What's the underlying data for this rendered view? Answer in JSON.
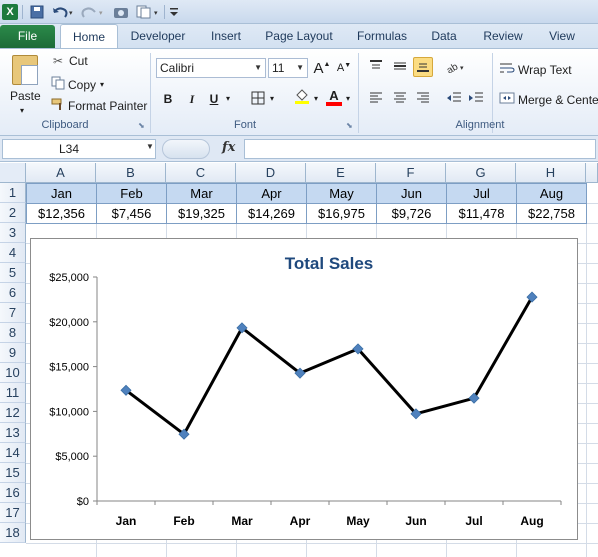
{
  "titlebar": {
    "logo": "X",
    "qa_icons": [
      "save-icon",
      "undo-icon",
      "redo-icon",
      "camera-icon",
      "copy-format-icon",
      "customize-icon"
    ]
  },
  "tabs": [
    "File",
    "Home",
    "Developer",
    "Insert",
    "Page Layout",
    "Formulas",
    "Data",
    "Review",
    "View"
  ],
  "ribbon": {
    "clipboard": {
      "paste": "Paste",
      "cut": "Cut",
      "copy": "Copy",
      "format_painter": "Format Painter",
      "label": "Clipboard"
    },
    "font": {
      "name": "Calibri",
      "size": "11",
      "grow": "A",
      "shrink": "A",
      "bold": "B",
      "italic": "I",
      "underline": "U",
      "fill_letter": "A",
      "label": "Font",
      "fill_color": "#ffff00",
      "font_color": "#ff0000"
    },
    "alignment": {
      "wrap_text": "Wrap Text",
      "merge_center": "Merge & Center",
      "label": "Alignment"
    }
  },
  "formula_bar": {
    "name_box": "L34",
    "fx": "fx",
    "formula": ""
  },
  "columns": [
    "A",
    "B",
    "C",
    "D",
    "E",
    "F",
    "G",
    "H"
  ],
  "rows": [
    "1",
    "2",
    "3",
    "4",
    "5",
    "6",
    "7",
    "8",
    "9",
    "10",
    "11",
    "12",
    "13",
    "14",
    "15",
    "16",
    "17",
    "18"
  ],
  "months": [
    "Jan",
    "Feb",
    "Mar",
    "Apr",
    "May",
    "Jun",
    "Jul",
    "Aug"
  ],
  "sales": [
    "$12,356",
    "$7,456",
    "$19,325",
    "$14,269",
    "$16,975",
    "$9,726",
    "$11,478",
    "$22,758"
  ],
  "chart_data": {
    "type": "line",
    "title": "Total Sales",
    "categories": [
      "Jan",
      "Feb",
      "Mar",
      "Apr",
      "May",
      "Jun",
      "Jul",
      "Aug"
    ],
    "values": [
      12356,
      7456,
      19325,
      14269,
      16975,
      9726,
      11478,
      22758
    ],
    "y_ticks": [
      "$0",
      "$5,000",
      "$10,000",
      "$15,000",
      "$20,000",
      "$25,000"
    ],
    "ylim": [
      0,
      25000
    ],
    "grid": false,
    "line_color": "#000000",
    "marker_color": "#4f81bd",
    "title_color": "#1f497d"
  }
}
